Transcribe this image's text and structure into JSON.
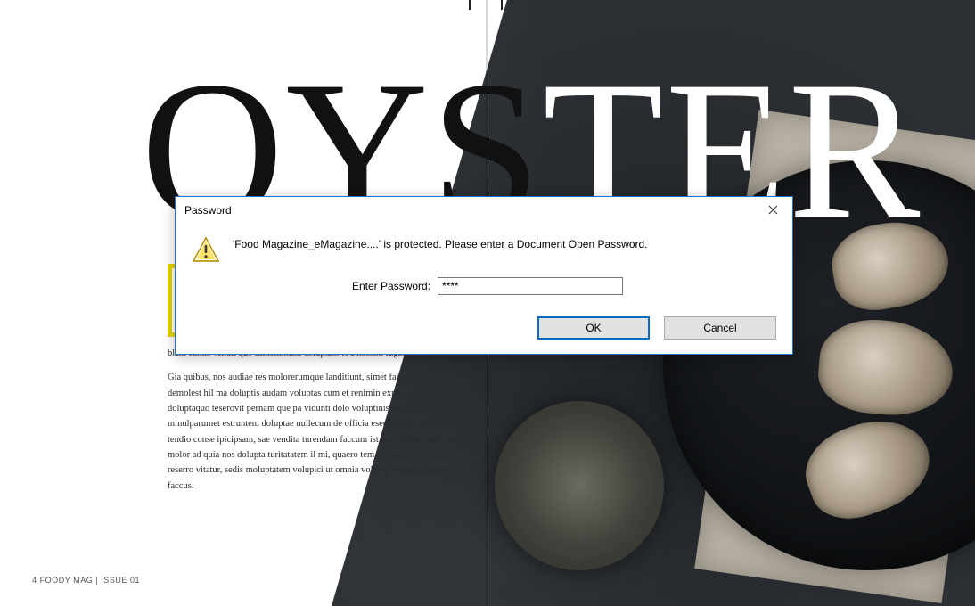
{
  "magazine": {
    "headline_left": "OYS",
    "headline_right": "TER",
    "body_p1": "blani suntis vendit que sumenimusa doluptam et a nossim fuga.",
    "body_p2": "Gia quibus, nos audiae res molorerumque landitiunt, simet faccumque demolest hil ma doluptis audam voluptas cum et renimin experes doleni doluptaquo teserovit pernam que pa vidunti dolo voluptinis nobis et minulparumet estruntem doluptae nullecum de officia esequatium aut ligni tendio conse ipicipsam, sae vendita turendam faccum ist harion nam quide pro molor ad quia nos dolupta turitatatem il mi, quaero tem sincitenis es nus reserro vitatur, sedis moluptatem volupici ut omnia volorep edigent ioratem faccus.",
    "folio": "4   FOODY MAG | ISSUE 01"
  },
  "dialog": {
    "title": "Password",
    "message": "'Food Magazine_eMagazine....' is protected. Please enter a Document Open Password.",
    "input_label": "Enter Password:",
    "input_value": "****",
    "ok_label": "OK",
    "cancel_label": "Cancel"
  }
}
